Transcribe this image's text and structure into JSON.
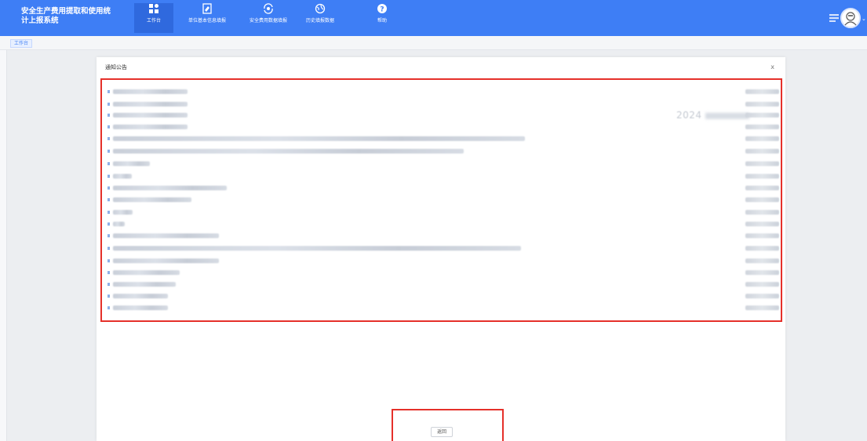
{
  "app": {
    "title": "安全生产费用提取和使用统计上报系统"
  },
  "nav": [
    {
      "label": "工作台",
      "icon": "grid-icon"
    },
    {
      "label": "单位基本信息填报",
      "icon": "edit-form-icon"
    },
    {
      "label": "安全费用数据填报",
      "icon": "money-refresh-icon"
    },
    {
      "label": "历史填报数据",
      "icon": "globe-icon"
    },
    {
      "label": "帮助",
      "icon": "help-icon"
    }
  ],
  "breadcrumb": {
    "label": "工作台"
  },
  "modal": {
    "title": "通知公告",
    "close": "x",
    "ghost_date": "2024",
    "return_label": "返回"
  },
  "notices": [
    {
      "text_width": 95
    },
    {
      "text_width": 95
    },
    {
      "text_width": 95
    },
    {
      "text_width": 95
    },
    {
      "text_width": 525
    },
    {
      "text_width": 447
    },
    {
      "text_width": 47
    },
    {
      "text_width": 24
    },
    {
      "text_width": 145
    },
    {
      "text_width": 100
    },
    {
      "text_width": 25
    },
    {
      "text_width": 15
    },
    {
      "text_width": 135
    },
    {
      "text_width": 520
    },
    {
      "text_width": 135
    },
    {
      "text_width": 85
    },
    {
      "text_width": 80
    },
    {
      "text_width": 70
    },
    {
      "text_width": 70
    }
  ],
  "colors": {
    "topbar": "#3e7ef5",
    "highlight_border": "#e5302a"
  }
}
